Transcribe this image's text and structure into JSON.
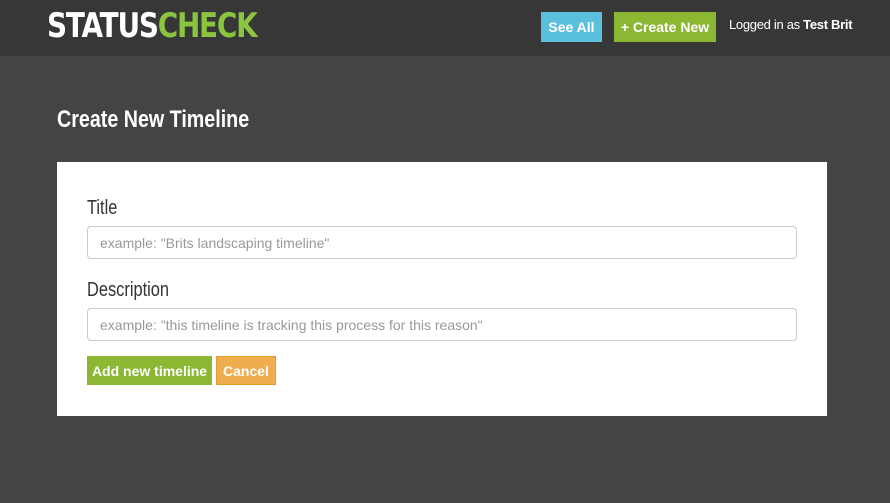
{
  "header": {
    "logo_part1": "STATUS",
    "logo_part2": "CHECK",
    "see_all_label": "See All",
    "create_new_label": "+ Create New",
    "logged_in_prefix": "Logged in as ",
    "user_name": "Test Brit"
  },
  "page": {
    "title": "Create New Timeline"
  },
  "form": {
    "title_label": "Title",
    "title_placeholder": "example: \"Brits landscaping timeline\"",
    "description_label": "Description",
    "description_placeholder": "example: \"this timeline is tracking this process for this reason\"",
    "submit_label": "Add new timeline",
    "cancel_label": "Cancel"
  },
  "colors": {
    "background": "#444444",
    "header": "#373737",
    "brand_green": "#8bc53f",
    "button_green": "#8bb732",
    "button_blue": "#5bc0de",
    "button_orange": "#f0ad4e"
  }
}
